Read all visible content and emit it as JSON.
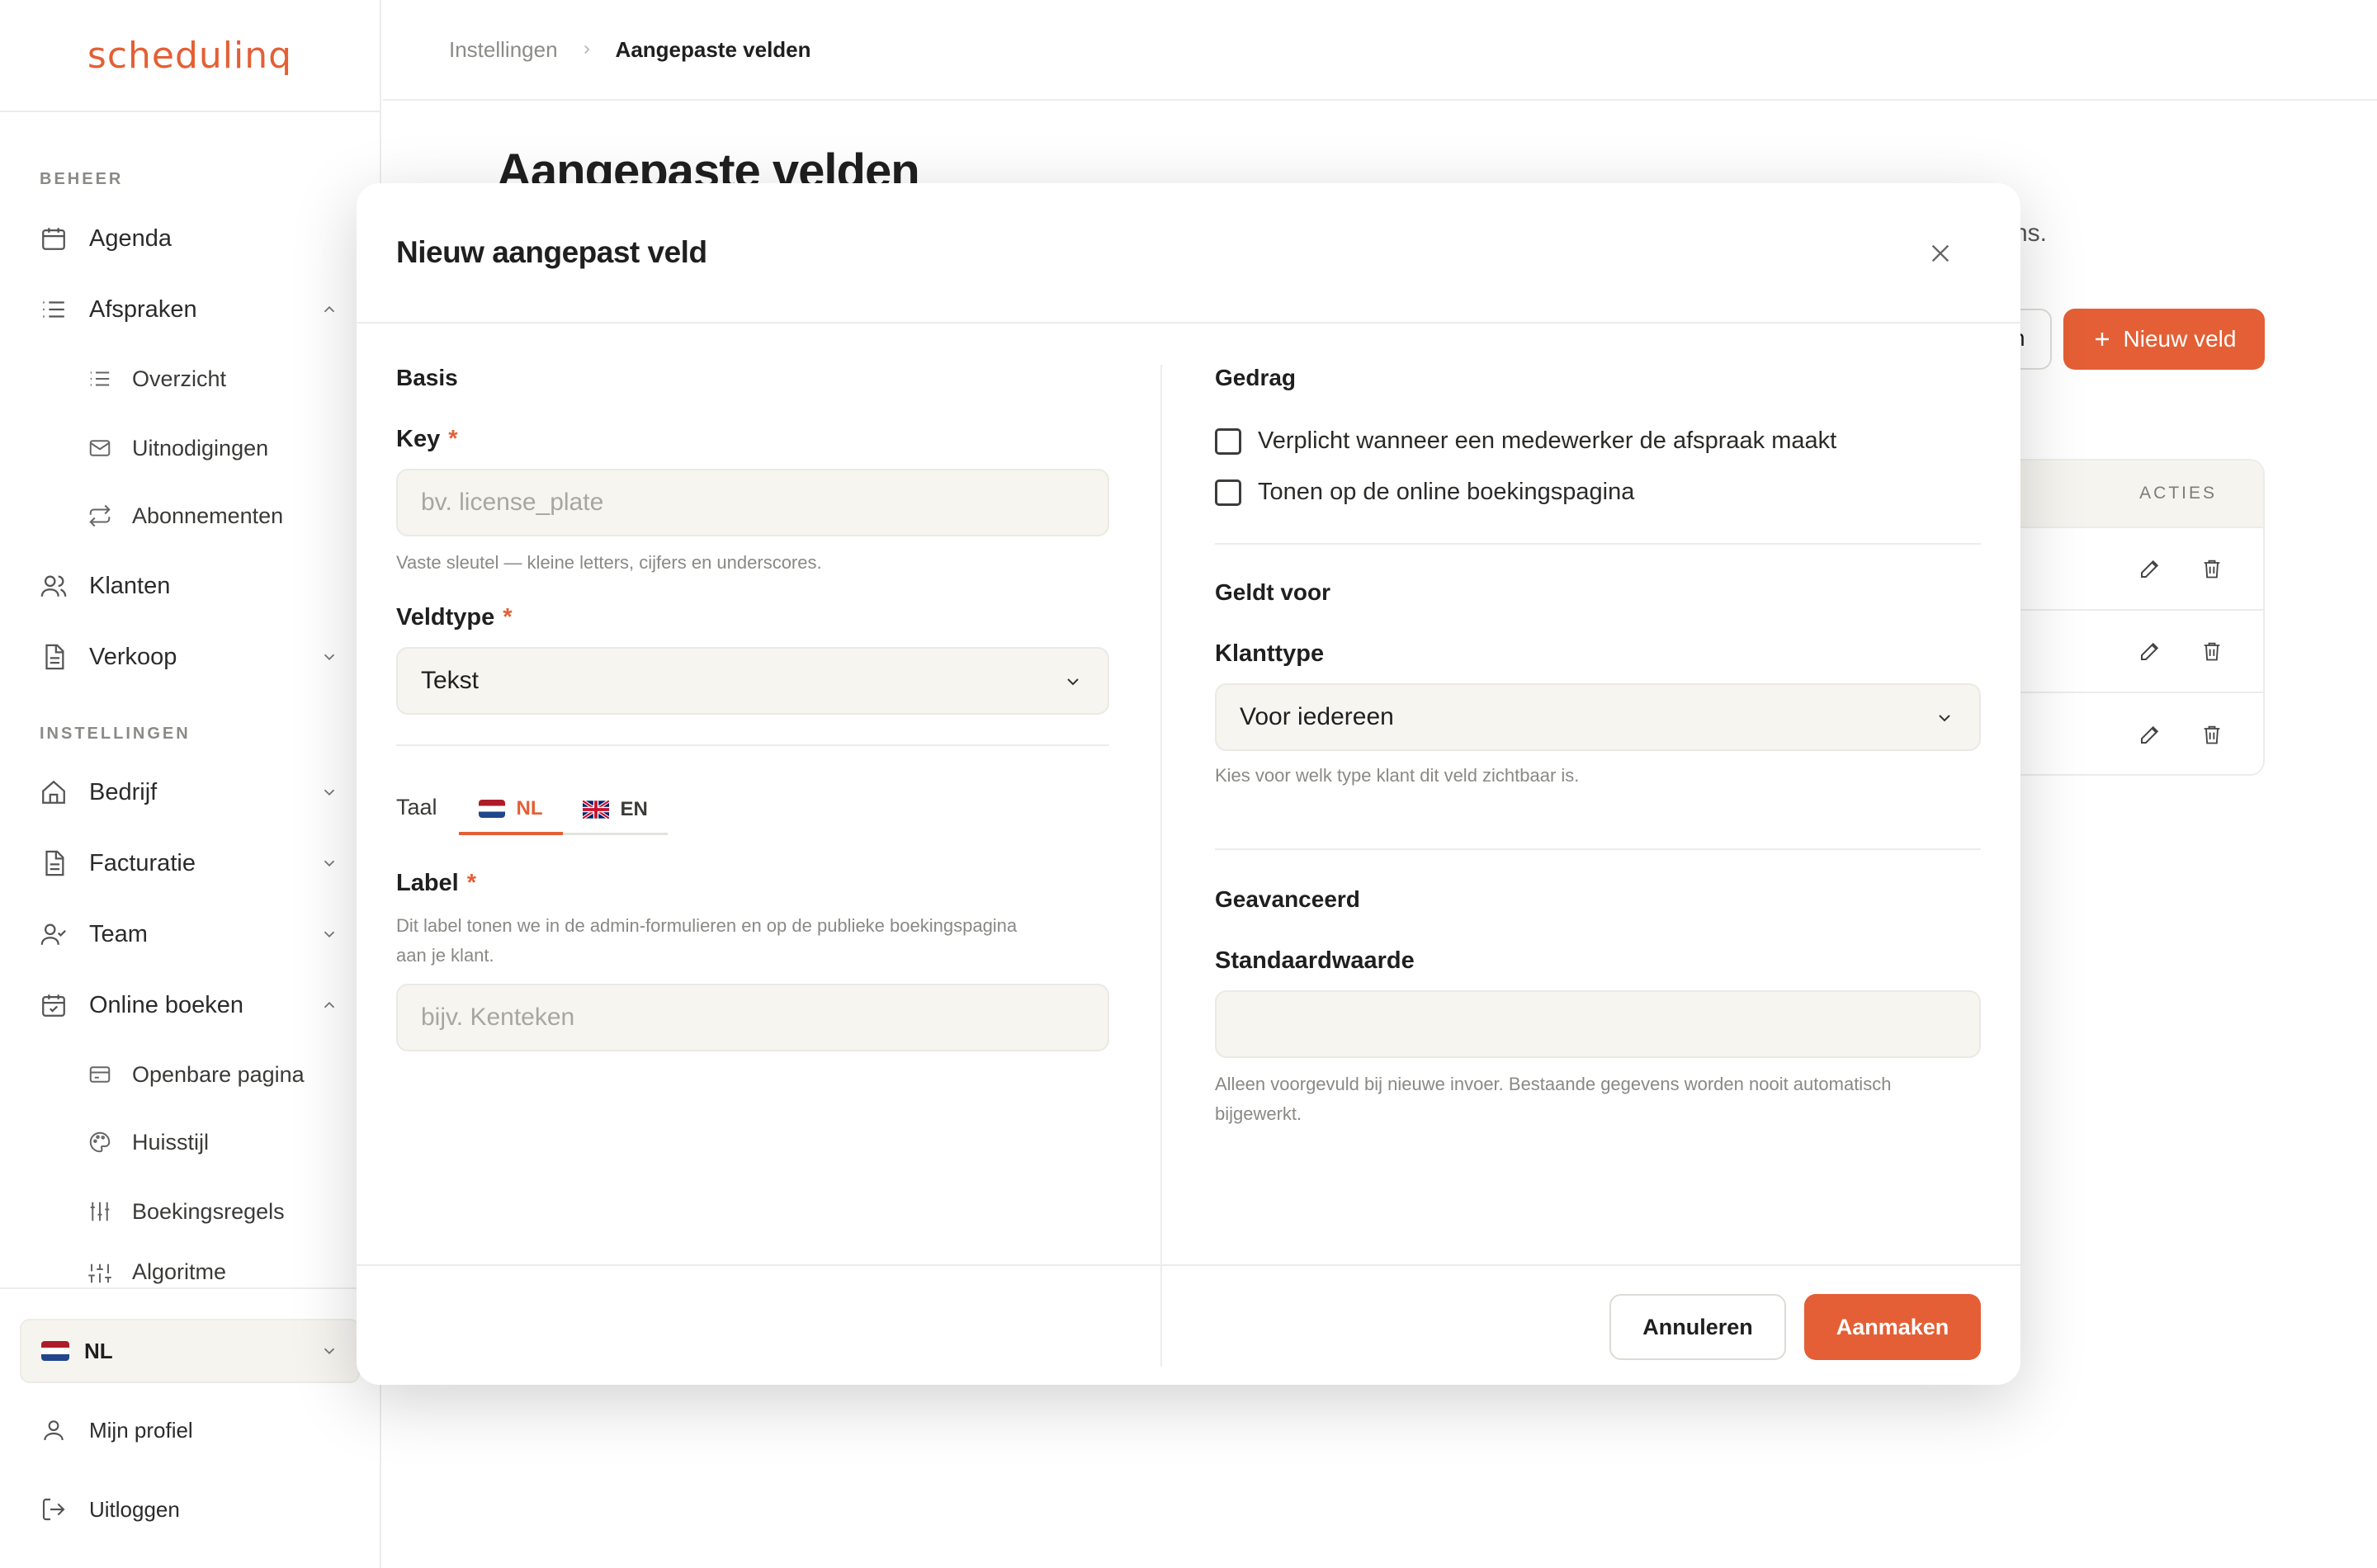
{
  "app": {
    "logo": "schedulinq"
  },
  "breadcrumb": {
    "parent": "Instellingen",
    "current": "Aangepaste velden"
  },
  "sidebar": {
    "section_beheer": "BEHEER",
    "section_instellingen": "INSTELLINGEN",
    "items": {
      "agenda": "Agenda",
      "afspraken": "Afspraken",
      "overzicht": "Overzicht",
      "uitnodigingen": "Uitnodigingen",
      "abonnementen": "Abonnementen",
      "klanten": "Klanten",
      "verkoop": "Verkoop",
      "bedrijf": "Bedrijf",
      "facturatie": "Facturatie",
      "team": "Team",
      "online_boeken": "Online boeken",
      "openbare_pagina": "Openbare pagina",
      "huisstijl": "Huisstijl",
      "boekingsregels": "Boekingsregels",
      "algoritme": "Algoritme"
    },
    "language": "NL",
    "profile": "Mijn profiel",
    "logout": "Uitloggen"
  },
  "page": {
    "title": "Aangepaste velden",
    "subtitle_fragment": "ns.",
    "outline_btn_fragment": "n",
    "new_field_button": "Nieuw veld",
    "table_header_actions": "ACTIES"
  },
  "modal": {
    "title": "Nieuw aangepast veld",
    "basis": {
      "title": "Basis",
      "key_label": "Key",
      "key_placeholder": "bv. license_plate",
      "key_help": "Vaste sleutel — kleine letters, cijfers en underscores.",
      "type_label": "Veldtype",
      "type_value": "Tekst",
      "lang_label": "Taal",
      "tab_nl": "NL",
      "tab_en": "EN",
      "label_label": "Label",
      "label_help_1": "Dit label tonen we in de admin-formulieren en op de publieke boekingspagina",
      "label_help_2": "aan je klant.",
      "label_placeholder": "bijv. Kenteken",
      "required_mark": "*"
    },
    "gedrag": {
      "title": "Gedrag",
      "check_required": "Verplicht wanneer een medewerker de afspraak maakt",
      "check_online": "Tonen op de online boekingspagina"
    },
    "geldt_voor": {
      "title": "Geldt voor",
      "klanttype_label": "Klanttype",
      "klanttype_value": "Voor iedereen",
      "klanttype_help": "Kies voor welk type klant dit veld zichtbaar is."
    },
    "geavanceerd": {
      "title": "Geavanceerd",
      "default_label": "Standaardwaarde",
      "default_value": "",
      "default_help_1": "Alleen voorgevuld bij nieuwe invoer. Bestaande gegevens worden nooit automatisch",
      "default_help_2": "bijgewerkt."
    },
    "cancel": "Annuleren",
    "create": "Aanmaken"
  },
  "colors": {
    "accent": "#e45f35",
    "input_bg": "#f7f5f0",
    "border": "#ececea"
  }
}
